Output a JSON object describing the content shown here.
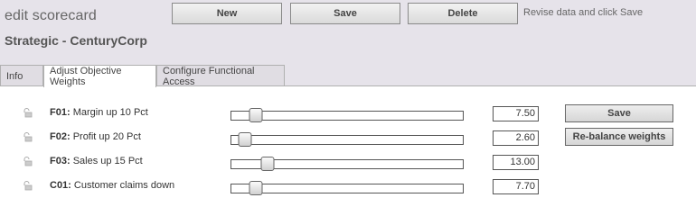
{
  "header": {
    "title": "edit scorecard",
    "subtitle": "Strategic - CenturyCorp",
    "buttons": {
      "new": "New",
      "save": "Save",
      "delete": "Delete"
    },
    "hint": "Revise data and click Save"
  },
  "tabs": [
    {
      "label": "Info",
      "active": false
    },
    {
      "label": "Adjust Objective Weights",
      "active": true
    },
    {
      "label": "Configure Functional Access",
      "active": false
    }
  ],
  "objectives": [
    {
      "code": "F01:",
      "name": "Margin up 10 Pct",
      "value": "7.50",
      "slider_fraction": 0.08
    },
    {
      "code": "F02:",
      "name": "Profit up 20 Pct",
      "value": "2.60",
      "slider_fraction": 0.03
    },
    {
      "code": "F03:",
      "name": "Sales up 15 Pct",
      "value": "13.00",
      "slider_fraction": 0.135
    },
    {
      "code": "C01:",
      "name": "Customer claims down",
      "value": "7.70",
      "slider_fraction": 0.08
    }
  ],
  "actions": {
    "save": "Save",
    "rebalance": "Re-balance weights"
  },
  "colors": {
    "header_bg": "#e6e3ea",
    "tab_inactive": "#e0dde3",
    "button_bg": "#e2e2e2"
  },
  "icons": {
    "lock": "lock-icon"
  }
}
